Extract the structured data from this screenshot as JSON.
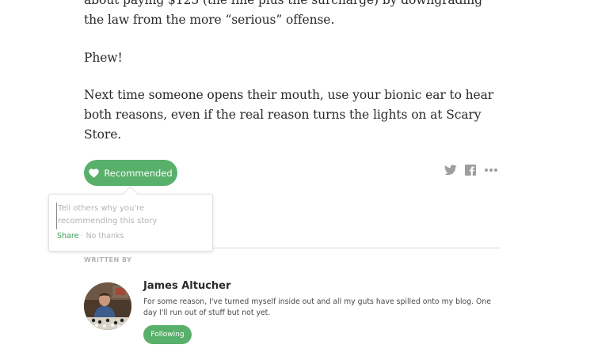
{
  "article": {
    "paragraph_1": "about paying $125 (the fine plus the surcharge) by downgrading the law from the more “serious” offense.",
    "paragraph_2": "Phew!",
    "paragraph_3": "Next time someone opens their mouth, use your bionic ear to hear both reasons, even if the real reason turns the lights on at Scary Store."
  },
  "actions": {
    "recommend_label": "Recommended",
    "icons": [
      "heart-icon",
      "twitter-icon",
      "facebook-icon",
      "more-icon"
    ]
  },
  "popover": {
    "placeholder": "Tell others why you're recommending this story",
    "share_label": "Share",
    "separator": "·",
    "no_thanks_label": "No thanks"
  },
  "author": {
    "section_label": "WRITTEN BY",
    "name": "James Altucher",
    "bio": "For some reason, I've turned myself inside out and all my guts have spilled onto my blog. One day I'll run out of stuff but not yet.",
    "follow_label": "Following"
  },
  "colors": {
    "accent": "#58b06b",
    "share_link": "#3aa055",
    "icon_gray": "#9e9e9e"
  }
}
